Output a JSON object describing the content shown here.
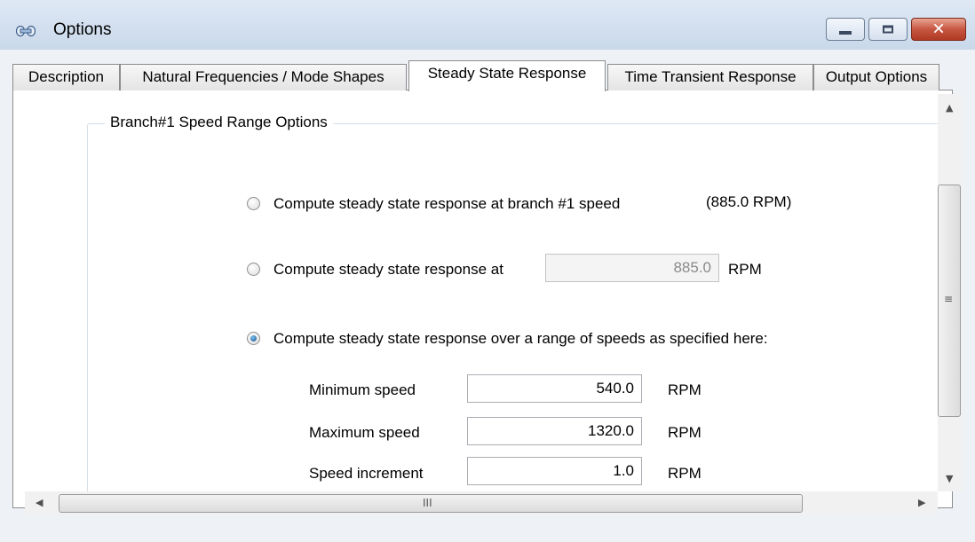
{
  "window": {
    "title": "Options",
    "controls": {
      "minimize": "minimize",
      "maximize": "maximize",
      "close": "✕"
    }
  },
  "tabs": [
    {
      "label": "Description",
      "active": false
    },
    {
      "label": "Natural Frequencies / Mode Shapes",
      "active": false
    },
    {
      "label": "Steady State Response",
      "active": true
    },
    {
      "label": "Time Transient Response",
      "active": false
    },
    {
      "label": "Output Options",
      "active": false
    }
  ],
  "group": {
    "title": "Branch#1 Speed Range Options",
    "option_branch_speed": {
      "label": "Compute steady state response at branch #1 speed",
      "note": "(885.0 RPM)",
      "checked": false
    },
    "option_fixed_speed": {
      "label": "Compute steady state response at",
      "value": "885.0",
      "unit": "RPM",
      "checked": false
    },
    "option_range": {
      "label": "Compute steady state response over a range of speeds as specified here:",
      "checked": true
    },
    "fields": [
      {
        "label": "Minimum speed",
        "value": "540.0",
        "unit": "RPM"
      },
      {
        "label": "Maximum speed",
        "value": "1320.0",
        "unit": "RPM"
      },
      {
        "label": "Speed increment",
        "value": "1.0",
        "unit": "RPM"
      }
    ]
  },
  "scrollbars": {
    "up_arrow": "▲",
    "down_arrow": "▼",
    "left_arrow": "◀",
    "right_arrow": "▶",
    "v_grip": "≡",
    "h_grip": "III"
  }
}
